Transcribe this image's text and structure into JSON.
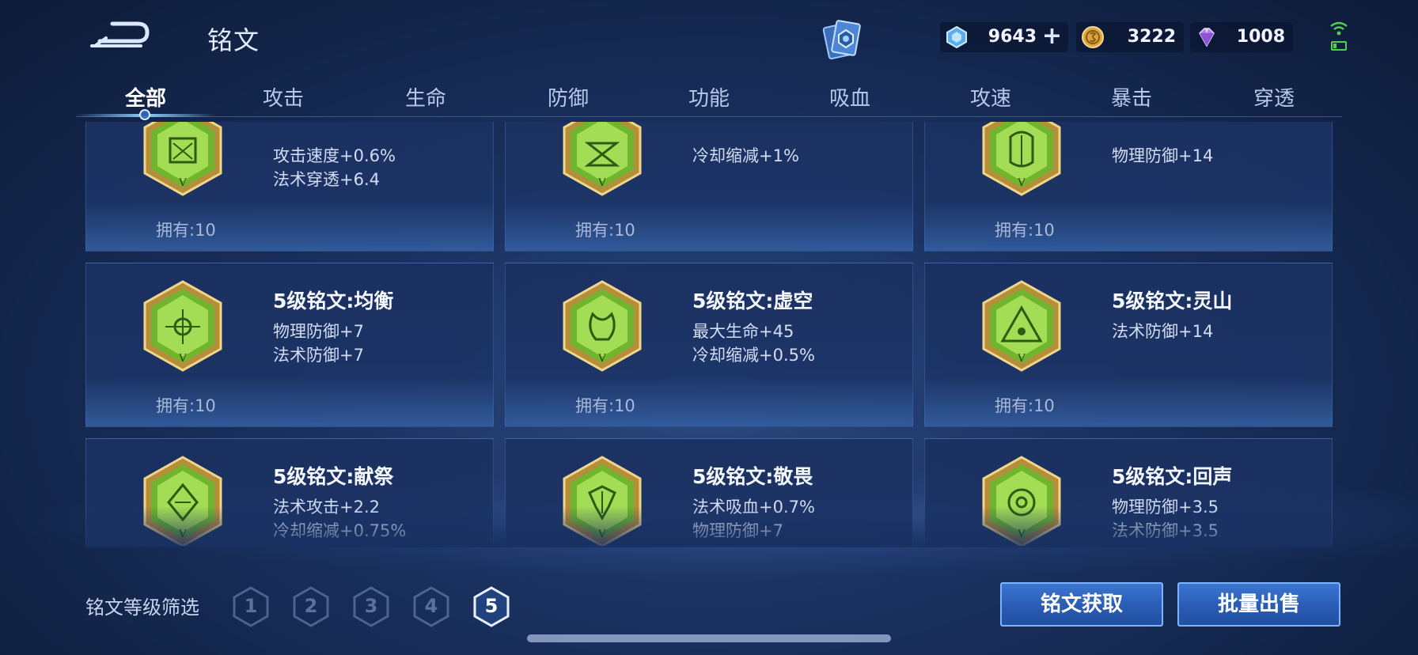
{
  "header": {
    "title": "铭文",
    "currencies": [
      {
        "name": "diamond-ticket",
        "value": "9643",
        "color": "#7ec8ff"
      },
      {
        "name": "gold-coin",
        "value": "3222",
        "color": "#e0b050"
      },
      {
        "name": "gem",
        "value": "1008",
        "color": "#c68cff"
      }
    ],
    "plus_label": "+"
  },
  "tabs": [
    "全部",
    "攻击",
    "生命",
    "防御",
    "功能",
    "吸血",
    "攻速",
    "暴击",
    "穿透"
  ],
  "active_tab": "全部",
  "runes": [
    {
      "name": "",
      "stats": [
        "攻击速度+0.6%",
        "法术穿透+6.4"
      ],
      "owned": "拥有:10",
      "level_mark": "V"
    },
    {
      "name": "",
      "stats": [
        "冷却缩减+1%",
        ""
      ],
      "owned": "拥有:10",
      "level_mark": "V"
    },
    {
      "name": "",
      "stats": [
        "物理防御+14",
        ""
      ],
      "owned": "拥有:10",
      "level_mark": "V"
    },
    {
      "name": "5级铭文:均衡",
      "stats": [
        "物理防御+7",
        "法术防御+7"
      ],
      "owned": "拥有:10",
      "level_mark": "V"
    },
    {
      "name": "5级铭文:虚空",
      "stats": [
        "最大生命+45",
        "冷却缩减+0.5%"
      ],
      "owned": "拥有:10",
      "level_mark": "V"
    },
    {
      "name": "5级铭文:灵山",
      "stats": [
        "法术防御+14",
        ""
      ],
      "owned": "拥有:10",
      "level_mark": "V"
    },
    {
      "name": "5级铭文:献祭",
      "stats": [
        "法术攻击+2.2",
        "冷却缩减+0.75%"
      ],
      "owned": "",
      "level_mark": "V"
    },
    {
      "name": "5级铭文:敬畏",
      "stats": [
        "法术吸血+0.7%",
        "物理防御+7"
      ],
      "owned": "",
      "level_mark": "V"
    },
    {
      "name": "5级铭文:回声",
      "stats": [
        "物理防御+3.5",
        "法术防御+3.5"
      ],
      "owned": "",
      "level_mark": "V"
    }
  ],
  "footer": {
    "filter_label": "铭文等级筛选",
    "levels": [
      "1",
      "2",
      "3",
      "4",
      "5"
    ],
    "active_level": "5",
    "get_button": "铭文获取",
    "sell_button": "批量出售"
  },
  "colors": {
    "rune_green": "#7cc43a",
    "rune_gold": "#c8a24a",
    "button_blue": "#2a5cb4"
  }
}
